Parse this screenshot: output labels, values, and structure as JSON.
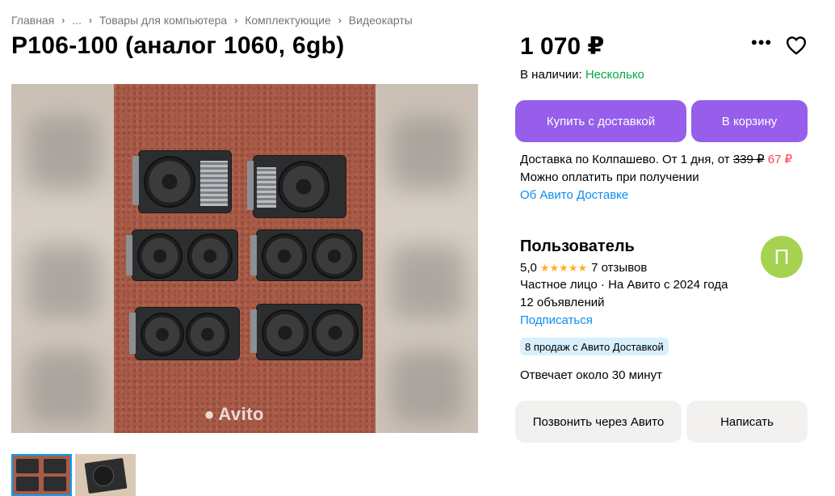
{
  "breadcrumb": {
    "items": [
      "Главная",
      "...",
      "Товары для компьютера",
      "Комплектующие",
      "Видеокарты"
    ]
  },
  "listing": {
    "title": "P106-100 (аналог 1060, 6gb)",
    "price": "1 070 ₽",
    "stock_label": "В наличии:",
    "stock_value": "Несколько",
    "watermark": "Avito"
  },
  "actions": {
    "buy_delivery": "Купить с доставкой",
    "add_to_cart": "В корзину",
    "call": "Позвонить через Авито",
    "write": "Написать"
  },
  "delivery": {
    "text_prefix": "Доставка по Колпашево. От 1 дня, от",
    "old_price": "339 ₽",
    "new_price": "67 ₽",
    "pay_on_receipt": "Можно оплатить при получении",
    "about_link": "Об Авито Доставке"
  },
  "seller": {
    "name": "Пользователь",
    "avatar_letter": "П",
    "rating": "5,0",
    "stars": "★★★★★",
    "reviews": "7 отзывов",
    "type_since": "Частное лицо · На Авито с 2024 года",
    "listings": "12 объявлений",
    "subscribe": "Подписаться",
    "sales_badge": "8 продаж с Авито Доставкой",
    "response_time": "Отвечает около 30 минут"
  },
  "colors": {
    "accent": "#965eeb",
    "link": "#0a8ef0",
    "in_stock": "#02a843",
    "discount": "#ff4053",
    "avatar": "#a5d24f"
  },
  "icons": {
    "more": "more-dots-icon",
    "favorite": "heart-icon",
    "separator": "chevron-right-icon"
  }
}
